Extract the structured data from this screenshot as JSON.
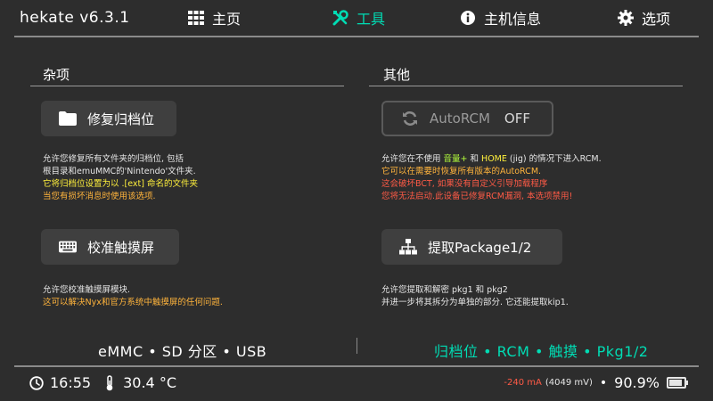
{
  "header": {
    "app_title": "hekate v6.3.1",
    "tabs": [
      {
        "label": "主页",
        "icon": "grid-icon",
        "active": false
      },
      {
        "label": "工具",
        "icon": "tools-icon",
        "active": true
      },
      {
        "label": "主机信息",
        "icon": "info-icon",
        "active": false
      },
      {
        "label": "选项",
        "icon": "gear-icon",
        "active": false
      }
    ]
  },
  "left": {
    "title": "杂项",
    "repair_button": {
      "label": "修复归档位",
      "icon": "folder-icon"
    },
    "repair_desc": [
      "允许您修复所有文件夹的归档位, 包括",
      "根目录和emuMMC的'Nintendo'文件夹.",
      "它将归档位设置为以 .[ext] 命名的文件夹",
      "当您有损坏消息时使用该选项."
    ],
    "calib_button": {
      "label": "校准触摸屏",
      "icon": "keyboard-icon"
    },
    "calib_desc": [
      "允许您校准触摸屏模块.",
      "这可以解决Nyx和官方系统中触摸屏的任何问题."
    ]
  },
  "right": {
    "title": "其他",
    "autorcm_button": {
      "label": "AutoRCM",
      "state": "OFF",
      "icon": "refresh-icon"
    },
    "autorcm_desc": {
      "line1_a": "允许您在不使用 ",
      "line1_b": "音量+",
      "line1_c": " 和 ",
      "line1_d": "HOME",
      "line1_e": " (jig) 的情况下进入RCM.",
      "line2": "它可以在需要时恢复所有版本的AutoRCM.",
      "line3": "这会破坏BCT, 如果没有自定义引导加载程序",
      "line4": "您将无法启动.此设备已修复RCM漏洞, 本选项禁用!"
    },
    "package_button": {
      "label": "提取Package1/2",
      "icon": "tree-icon"
    },
    "package_desc": [
      "允许您提取和解密 pkg1 和 pkg2",
      "并进一步将其拆分为单独的部分. 它还能提取kip1."
    ]
  },
  "footer": {
    "left_label": "eMMC • SD 分区 • USB",
    "right_label": "归档位 • RCM • 触摸 • Pkg1/2"
  },
  "status": {
    "time": "16:55",
    "temperature": "30.4 °C",
    "current": "-240 mA",
    "voltage": "(4049 mV)",
    "battery_percent": "90.9%",
    "battery_level": 0.909
  },
  "colors": {
    "accent": "#00dcb4",
    "background": "#2d2d2d",
    "warning_orange": "#ffb43c",
    "warning_red": "#ff5a46",
    "highlight_yellow": "#fff03c",
    "highlight_green": "#b4ff3c"
  }
}
